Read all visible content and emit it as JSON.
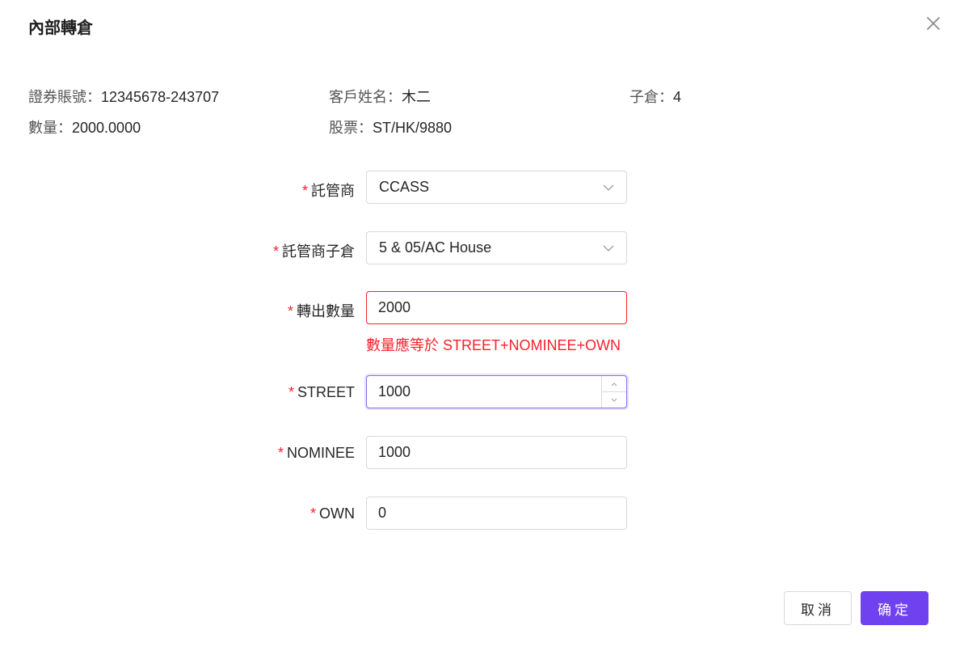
{
  "dialog": {
    "title": "內部轉倉",
    "close_icon": "close-icon"
  },
  "info": {
    "account_label": "證券賬號：",
    "account_value": "12345678-243707",
    "customer_label": "客戶姓名：",
    "customer_value": "木二",
    "subwarehouse_label": "子倉：",
    "subwarehouse_value": "4",
    "quantity_label": "數量：",
    "quantity_value": "2000.0000",
    "stock_label": "股票：",
    "stock_value": "ST/HK/9880"
  },
  "form": {
    "required_mark": "*",
    "custodian": {
      "label": "託管商",
      "value": "CCASS"
    },
    "custodian_sub": {
      "label": "託管商子倉",
      "value": "5 & 05/AC House"
    },
    "transfer_qty": {
      "label": "轉出數量",
      "value": "2000",
      "error": "數量應等於 STREET+NOMINEE+OWN"
    },
    "street": {
      "label": "STREET",
      "value": "1000"
    },
    "nominee": {
      "label": "NOMINEE",
      "value": "1000"
    },
    "own": {
      "label": "OWN",
      "value": "0"
    }
  },
  "footer": {
    "cancel_label": "取消",
    "ok_label": "确定"
  },
  "colors": {
    "primary": "#7042ef",
    "error": "#f5222d",
    "focus_border": "#8b6cf2"
  }
}
